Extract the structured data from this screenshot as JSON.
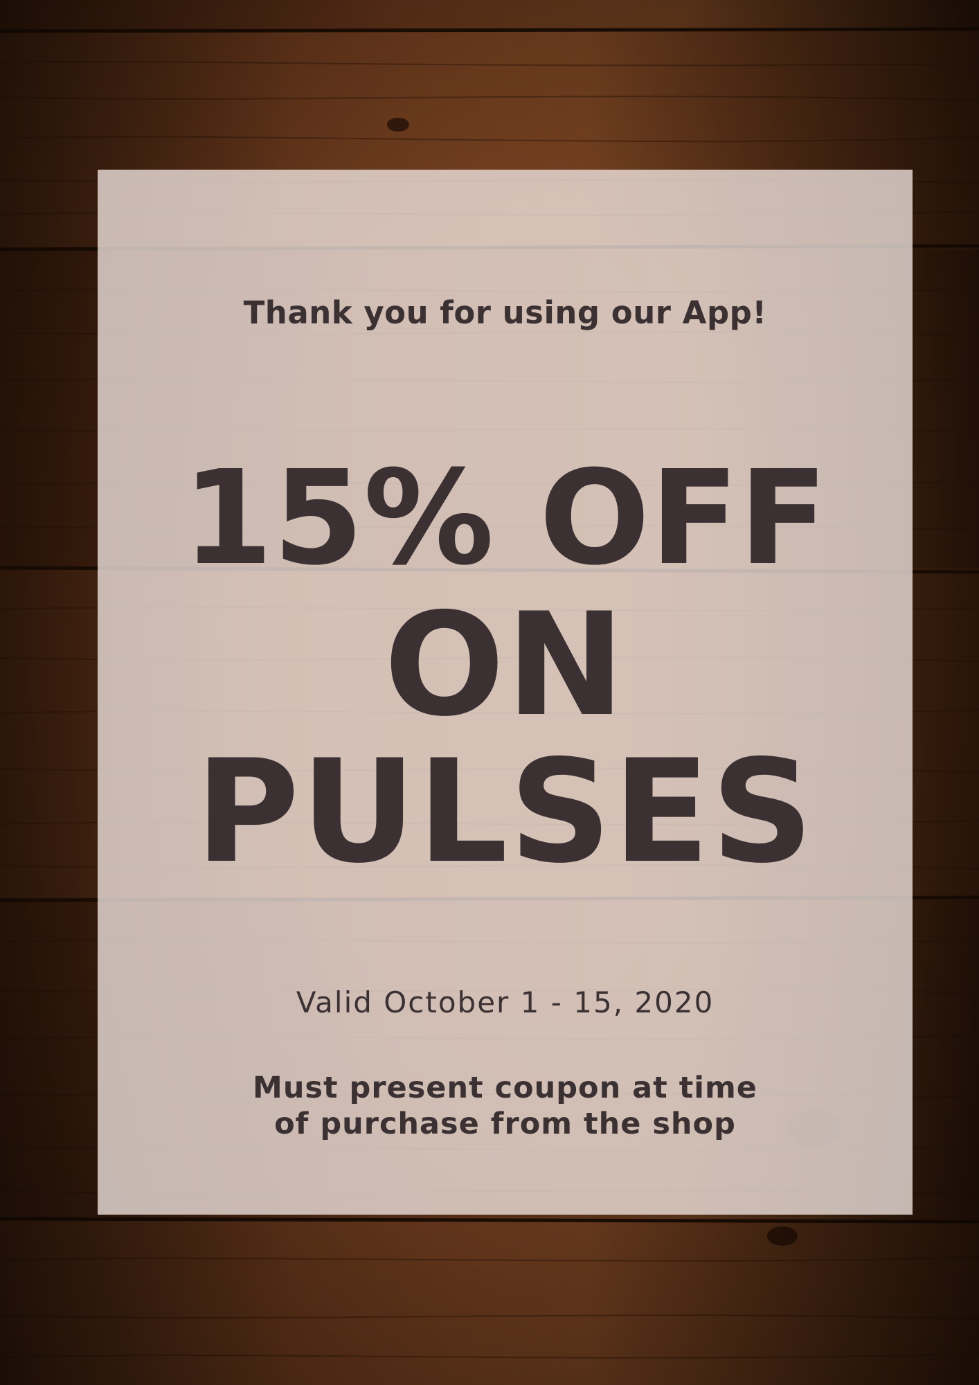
{
  "coupon": {
    "greeting": "Thank you for using our App!",
    "headline": {
      "line1": "15% OFF",
      "line2": "ON",
      "line3": "PULSES"
    },
    "validity": "Valid October 1 - 15, 2020",
    "terms": {
      "line1": "Must present coupon at time",
      "line2": "of purchase from the shop"
    }
  },
  "colors": {
    "text": "#3b3133",
    "panel": "#eee1dc",
    "wood_dark": "#3a2010",
    "wood_mid": "#6b3a1e"
  }
}
